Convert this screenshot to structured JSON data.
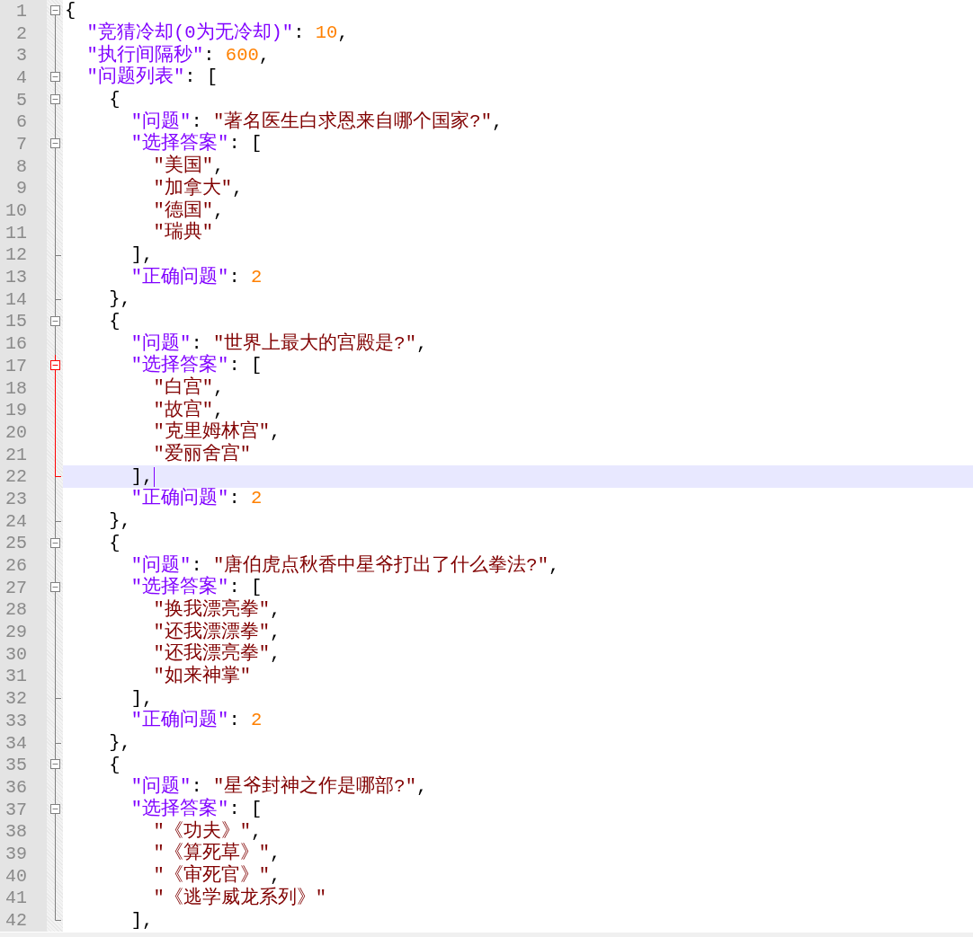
{
  "lines": [
    {
      "number": "1",
      "kind": "head",
      "active": false,
      "current": false,
      "tokens": [
        {
          "kind": "punct",
          "text": "{"
        }
      ]
    },
    {
      "number": "2",
      "kind": "mid",
      "active": false,
      "current": false,
      "tokens": [
        {
          "kind": "key",
          "text": "  \"竞猜冷却(0为无冷却)\""
        },
        {
          "kind": "punct",
          "text": ": "
        },
        {
          "kind": "number",
          "text": "10"
        },
        {
          "kind": "punct",
          "text": ","
        }
      ]
    },
    {
      "number": "3",
      "kind": "mid",
      "active": false,
      "current": false,
      "tokens": [
        {
          "kind": "key",
          "text": "  \"执行间隔秒\""
        },
        {
          "kind": "punct",
          "text": ": "
        },
        {
          "kind": "number",
          "text": "600"
        },
        {
          "kind": "punct",
          "text": ","
        }
      ]
    },
    {
      "number": "4",
      "kind": "open",
      "active": false,
      "current": false,
      "tokens": [
        {
          "kind": "key",
          "text": "  \"问题列表\""
        },
        {
          "kind": "punct",
          "text": ": ["
        }
      ]
    },
    {
      "number": "5",
      "kind": "open",
      "active": false,
      "current": false,
      "tokens": [
        {
          "kind": "punct",
          "text": "    {"
        }
      ]
    },
    {
      "number": "6",
      "kind": "mid",
      "active": false,
      "current": false,
      "tokens": [
        {
          "kind": "key",
          "text": "      \"问题\""
        },
        {
          "kind": "punct",
          "text": ": "
        },
        {
          "kind": "string",
          "text": "\"著名医生白求恩来自哪个国家?\""
        },
        {
          "kind": "punct",
          "text": ","
        }
      ]
    },
    {
      "number": "7",
      "kind": "open",
      "active": false,
      "current": false,
      "tokens": [
        {
          "kind": "key",
          "text": "      \"选择答案\""
        },
        {
          "kind": "punct",
          "text": ": ["
        }
      ]
    },
    {
      "number": "8",
      "kind": "mid",
      "active": false,
      "current": false,
      "tokens": [
        {
          "kind": "string",
          "text": "        \"美国\""
        },
        {
          "kind": "punct",
          "text": ","
        }
      ]
    },
    {
      "number": "9",
      "kind": "mid",
      "active": false,
      "current": false,
      "tokens": [
        {
          "kind": "string",
          "text": "        \"加拿大\""
        },
        {
          "kind": "punct",
          "text": ","
        }
      ]
    },
    {
      "number": "10",
      "kind": "mid",
      "active": false,
      "current": false,
      "tokens": [
        {
          "kind": "string",
          "text": "        \"德国\""
        },
        {
          "kind": "punct",
          "text": ","
        }
      ]
    },
    {
      "number": "11",
      "kind": "mid",
      "active": false,
      "current": false,
      "tokens": [
        {
          "kind": "string",
          "text": "        \"瑞典\""
        }
      ]
    },
    {
      "number": "12",
      "kind": "end",
      "active": false,
      "current": false,
      "tokens": [
        {
          "kind": "punct",
          "text": "      ],"
        }
      ]
    },
    {
      "number": "13",
      "kind": "mid",
      "active": false,
      "current": false,
      "tokens": [
        {
          "kind": "key",
          "text": "      \"正确问题\""
        },
        {
          "kind": "punct",
          "text": ": "
        },
        {
          "kind": "number",
          "text": "2"
        }
      ]
    },
    {
      "number": "14",
      "kind": "end",
      "active": false,
      "current": false,
      "tokens": [
        {
          "kind": "punct",
          "text": "    },"
        }
      ]
    },
    {
      "number": "15",
      "kind": "open",
      "active": false,
      "current": false,
      "tokens": [
        {
          "kind": "punct",
          "text": "    {"
        }
      ]
    },
    {
      "number": "16",
      "kind": "mid",
      "active": false,
      "current": false,
      "tokens": [
        {
          "kind": "key",
          "text": "      \"问题\""
        },
        {
          "kind": "punct",
          "text": ": "
        },
        {
          "kind": "string",
          "text": "\"世界上最大的宫殿是?\""
        },
        {
          "kind": "punct",
          "text": ","
        }
      ]
    },
    {
      "number": "17",
      "kind": "open",
      "active": true,
      "current": false,
      "tokens": [
        {
          "kind": "key",
          "text": "      \"选择答案\""
        },
        {
          "kind": "punct",
          "text": ": ["
        }
      ]
    },
    {
      "number": "18",
      "kind": "mid",
      "active": true,
      "current": false,
      "tokens": [
        {
          "kind": "string",
          "text": "        \"白宫\""
        },
        {
          "kind": "punct",
          "text": ","
        }
      ]
    },
    {
      "number": "19",
      "kind": "mid",
      "active": true,
      "current": false,
      "tokens": [
        {
          "kind": "string",
          "text": "        \"故宫\""
        },
        {
          "kind": "punct",
          "text": ","
        }
      ]
    },
    {
      "number": "20",
      "kind": "mid",
      "active": true,
      "current": false,
      "tokens": [
        {
          "kind": "string",
          "text": "        \"克里姆林宫\""
        },
        {
          "kind": "punct",
          "text": ","
        }
      ]
    },
    {
      "number": "21",
      "kind": "mid",
      "active": true,
      "current": false,
      "tokens": [
        {
          "kind": "string",
          "text": "        \"爱丽舍宫\""
        }
      ]
    },
    {
      "number": "22",
      "kind": "end",
      "active": true,
      "current": true,
      "tokens": [
        {
          "kind": "punct",
          "text": "      ],"
        }
      ]
    },
    {
      "number": "23",
      "kind": "mid",
      "active": false,
      "current": false,
      "tokens": [
        {
          "kind": "key",
          "text": "      \"正确问题\""
        },
        {
          "kind": "punct",
          "text": ": "
        },
        {
          "kind": "number",
          "text": "2"
        }
      ]
    },
    {
      "number": "24",
      "kind": "end",
      "active": false,
      "current": false,
      "tokens": [
        {
          "kind": "punct",
          "text": "    },"
        }
      ]
    },
    {
      "number": "25",
      "kind": "open",
      "active": false,
      "current": false,
      "tokens": [
        {
          "kind": "punct",
          "text": "    {"
        }
      ]
    },
    {
      "number": "26",
      "kind": "mid",
      "active": false,
      "current": false,
      "tokens": [
        {
          "kind": "key",
          "text": "      \"问题\""
        },
        {
          "kind": "punct",
          "text": ": "
        },
        {
          "kind": "string",
          "text": "\"唐伯虎点秋香中星爷打出了什么拳法?\""
        },
        {
          "kind": "punct",
          "text": ","
        }
      ]
    },
    {
      "number": "27",
      "kind": "open",
      "active": false,
      "current": false,
      "tokens": [
        {
          "kind": "key",
          "text": "      \"选择答案\""
        },
        {
          "kind": "punct",
          "text": ": ["
        }
      ]
    },
    {
      "number": "28",
      "kind": "mid",
      "active": false,
      "current": false,
      "tokens": [
        {
          "kind": "string",
          "text": "        \"换我漂亮拳\""
        },
        {
          "kind": "punct",
          "text": ","
        }
      ]
    },
    {
      "number": "29",
      "kind": "mid",
      "active": false,
      "current": false,
      "tokens": [
        {
          "kind": "string",
          "text": "        \"还我漂漂拳\""
        },
        {
          "kind": "punct",
          "text": ","
        }
      ]
    },
    {
      "number": "30",
      "kind": "mid",
      "active": false,
      "current": false,
      "tokens": [
        {
          "kind": "string",
          "text": "        \"还我漂亮拳\""
        },
        {
          "kind": "punct",
          "text": ","
        }
      ]
    },
    {
      "number": "31",
      "kind": "mid",
      "active": false,
      "current": false,
      "tokens": [
        {
          "kind": "string",
          "text": "        \"如来神掌\""
        }
      ]
    },
    {
      "number": "32",
      "kind": "end",
      "active": false,
      "current": false,
      "tokens": [
        {
          "kind": "punct",
          "text": "      ],"
        }
      ]
    },
    {
      "number": "33",
      "kind": "mid",
      "active": false,
      "current": false,
      "tokens": [
        {
          "kind": "key",
          "text": "      \"正确问题\""
        },
        {
          "kind": "punct",
          "text": ": "
        },
        {
          "kind": "number",
          "text": "2"
        }
      ]
    },
    {
      "number": "34",
      "kind": "end",
      "active": false,
      "current": false,
      "tokens": [
        {
          "kind": "punct",
          "text": "    },"
        }
      ]
    },
    {
      "number": "35",
      "kind": "open",
      "active": false,
      "current": false,
      "tokens": [
        {
          "kind": "punct",
          "text": "    {"
        }
      ]
    },
    {
      "number": "36",
      "kind": "mid",
      "active": false,
      "current": false,
      "tokens": [
        {
          "kind": "key",
          "text": "      \"问题\""
        },
        {
          "kind": "punct",
          "text": ": "
        },
        {
          "kind": "string",
          "text": "\"星爷封神之作是哪部?\""
        },
        {
          "kind": "punct",
          "text": ","
        }
      ]
    },
    {
      "number": "37",
      "kind": "open",
      "active": false,
      "current": false,
      "tokens": [
        {
          "kind": "key",
          "text": "      \"选择答案\""
        },
        {
          "kind": "punct",
          "text": ": ["
        }
      ]
    },
    {
      "number": "38",
      "kind": "mid",
      "active": false,
      "current": false,
      "tokens": [
        {
          "kind": "string",
          "text": "        \"《功夫》\""
        },
        {
          "kind": "punct",
          "text": ","
        }
      ]
    },
    {
      "number": "39",
      "kind": "mid",
      "active": false,
      "current": false,
      "tokens": [
        {
          "kind": "string",
          "text": "        \"《算死草》\""
        },
        {
          "kind": "punct",
          "text": ","
        }
      ]
    },
    {
      "number": "40",
      "kind": "mid",
      "active": false,
      "current": false,
      "tokens": [
        {
          "kind": "string",
          "text": "        \"《审死官》\""
        },
        {
          "kind": "punct",
          "text": ","
        }
      ]
    },
    {
      "number": "41",
      "kind": "mid",
      "active": false,
      "current": false,
      "tokens": [
        {
          "kind": "string",
          "text": "        \"《逃学威龙系列》\""
        }
      ]
    },
    {
      "number": "42",
      "kind": "end",
      "active": false,
      "current": false,
      "tokens": [
        {
          "kind": "punct",
          "text": "      ],"
        }
      ]
    }
  ]
}
